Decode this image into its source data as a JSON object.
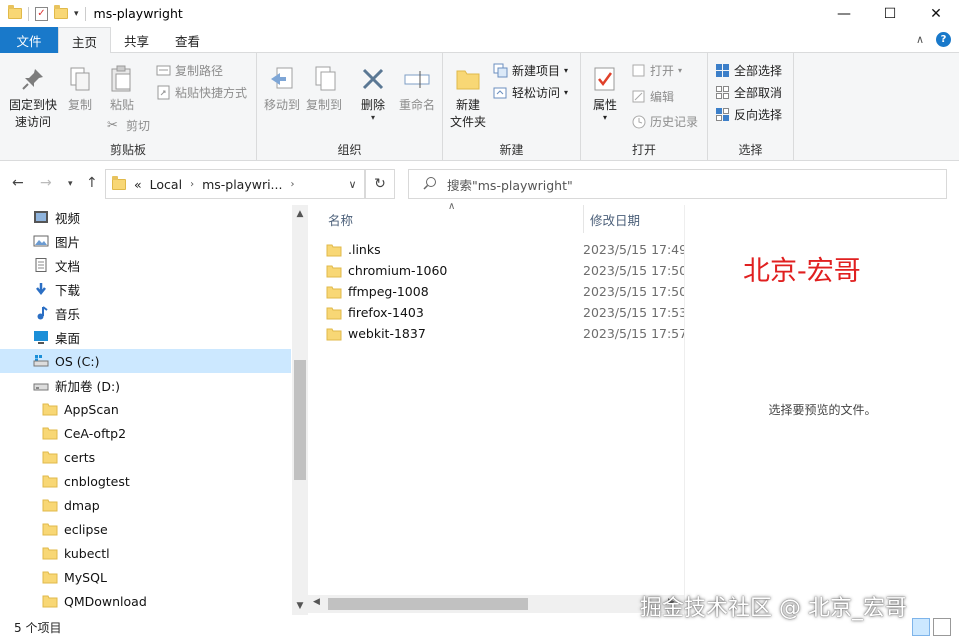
{
  "window": {
    "title": "ms-playwright",
    "minimize_glyph": "—",
    "maximize_glyph": "☐",
    "close_glyph": "✕"
  },
  "ribbon_tabs": [
    {
      "label": "文件"
    },
    {
      "label": "主页"
    },
    {
      "label": "共享"
    },
    {
      "label": "查看"
    }
  ],
  "ribbon": {
    "clipboard": {
      "label": "剪贴板",
      "pin": "固定到快\n速访问",
      "pin1": "固定到快",
      "pin2": "速访问",
      "copy": "复制",
      "paste": "粘贴",
      "copy_path": "复制路径",
      "paste_shortcut": "粘贴快捷方式",
      "cut": "剪切"
    },
    "organize": {
      "label": "组织",
      "move_to": "移动到",
      "copy_to": "复制到",
      "delete": "删除",
      "rename": "重命名"
    },
    "new": {
      "label": "新建",
      "new_folder1": "新建",
      "new_folder2": "文件夹",
      "new_item": "新建项目",
      "easy_access": "轻松访问"
    },
    "open": {
      "label": "打开",
      "properties": "属性",
      "open": "打开",
      "edit": "编辑",
      "history": "历史记录"
    },
    "select": {
      "label": "选择",
      "select_all": "全部选择",
      "select_none": "全部取消",
      "invert": "反向选择"
    }
  },
  "address": {
    "prefix": "«",
    "crumbs": [
      "Local",
      "ms-playwri..."
    ],
    "search_placeholder": "搜索\"ms-playwright\""
  },
  "nav_tree": [
    {
      "label": "视频",
      "icon": "video-icon"
    },
    {
      "label": "图片",
      "icon": "pictures-icon"
    },
    {
      "label": "文档",
      "icon": "documents-icon"
    },
    {
      "label": "下载",
      "icon": "download-icon"
    },
    {
      "label": "音乐",
      "icon": "music-icon"
    },
    {
      "label": "桌面",
      "icon": "desktop-icon"
    },
    {
      "label": "OS (C:)",
      "icon": "drive-c-icon",
      "selected": true
    },
    {
      "label": "新加卷 (D:)",
      "icon": "drive-d-icon"
    },
    {
      "label": "AppScan",
      "icon": "folder-icon"
    },
    {
      "label": "CeA-oftp2",
      "icon": "folder-icon"
    },
    {
      "label": "certs",
      "icon": "folder-icon"
    },
    {
      "label": "cnblogtest",
      "icon": "folder-icon"
    },
    {
      "label": "dmap",
      "icon": "folder-icon"
    },
    {
      "label": "eclipse",
      "icon": "folder-icon"
    },
    {
      "label": "kubectl",
      "icon": "folder-icon"
    },
    {
      "label": "MySQL",
      "icon": "folder-icon"
    },
    {
      "label": "QMDownload",
      "icon": "folder-icon"
    }
  ],
  "columns": {
    "name": "名称",
    "date": "修改日期"
  },
  "files": [
    {
      "name": ".links",
      "date": "2023/5/15 17:49"
    },
    {
      "name": "chromium-1060",
      "date": "2023/5/15 17:50"
    },
    {
      "name": "ffmpeg-1008",
      "date": "2023/5/15 17:50"
    },
    {
      "name": "firefox-1403",
      "date": "2023/5/15 17:53"
    },
    {
      "name": "webkit-1837",
      "date": "2023/5/15 17:57"
    }
  ],
  "preview": {
    "watermark": "北京-宏哥",
    "message": "选择要预览的文件。"
  },
  "status": {
    "count": "5 个项目"
  },
  "watermark_bottom": "掘金技术社区 @ 北京_宏哥"
}
